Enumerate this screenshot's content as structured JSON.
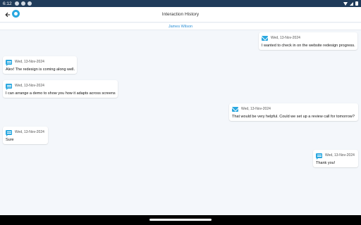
{
  "status_bar": {
    "time": "6:12"
  },
  "app_bar": {
    "title": "Interaction History"
  },
  "contact": {
    "name": "James Wilson"
  },
  "messages": [
    {
      "type": "email",
      "date": "Wed, 13-Nov-2024",
      "text": "I wanted to check in on the website redesign progress."
    },
    {
      "type": "chat",
      "date": "Wed, 13-Nov-2024",
      "text": "Alex! The redesign is coming along well."
    },
    {
      "type": "chat",
      "date": "Wed, 13-Nov-2024",
      "text": "I can arrange a demo to show you how it adapts across screens"
    },
    {
      "type": "email",
      "date": "Wed, 13-Nov-2024",
      "text": "That would be very helpful. Could we set up a review call for tomorrow?"
    },
    {
      "type": "chat",
      "date": "Wed, 13-Nov-2024",
      "text": "Sure"
    },
    {
      "type": "chat",
      "date": "Wed, 13-Nov-2024",
      "text": "Thank you!"
    }
  ],
  "colors": {
    "accent": "#2aa8e0",
    "contact_name": "#2b8fd6",
    "status_bar": "#1f3b5a"
  }
}
